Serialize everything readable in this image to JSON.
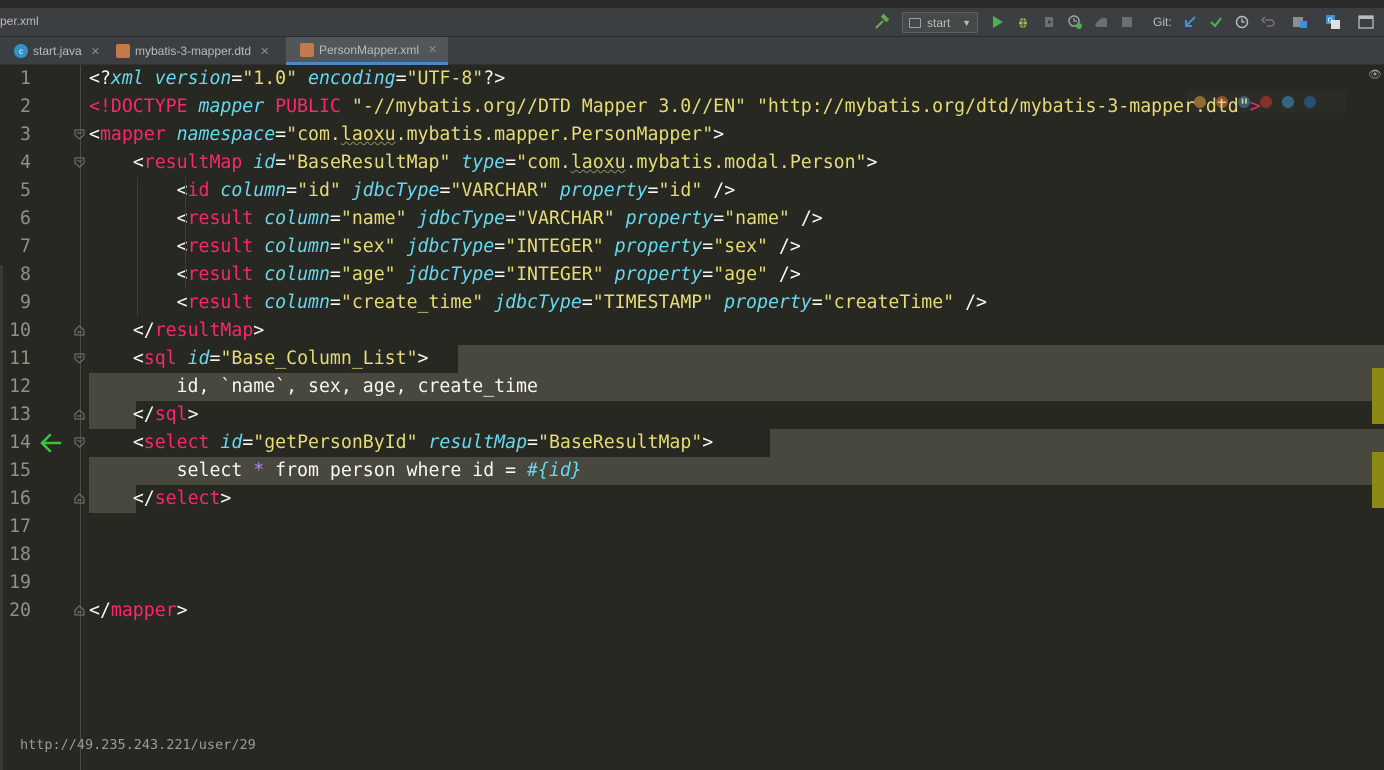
{
  "window": {
    "breadcrumb": "per.xml"
  },
  "toolbar": {
    "run_config": "start",
    "git_label": "Git:",
    "icons": [
      "hammer-icon",
      "run-icon",
      "debug-icon",
      "coverage-icon",
      "profile-icon",
      "attach-icon",
      "stop-icon",
      "git-update-icon",
      "git-commit-icon",
      "git-history-icon",
      "git-revert-icon",
      "project-structure-icon",
      "translate-icon",
      "terminal-icon"
    ],
    "colors": {
      "run": "#4caf50",
      "debug": "#9abe47",
      "update": "#3d8fd6"
    }
  },
  "tabs": [
    {
      "label": "start.java",
      "icon": "java-class-icon",
      "active": false
    },
    {
      "label": "mybatis-3-mapper.dtd",
      "icon": "dtd-file-icon",
      "active": false
    },
    {
      "label": "PersonMapper.xml",
      "icon": "xml-file-icon",
      "active": true
    }
  ],
  "editor": {
    "lines": [
      {
        "n": "1",
        "tokens": [
          [
            "pi",
            "<?"
          ],
          [
            "attr",
            "xml"
          ],
          [
            "plain",
            " "
          ],
          [
            "attr",
            "version"
          ],
          [
            "plain",
            "="
          ],
          [
            "str",
            "\"1.0\""
          ],
          [
            "plain",
            " "
          ],
          [
            "attr",
            "encoding"
          ],
          [
            "plain",
            "="
          ],
          [
            "str",
            "\"UTF-8\""
          ],
          [
            "pi",
            "?>"
          ]
        ]
      },
      {
        "n": "2",
        "tokens": [
          [
            "tag",
            "<!DOCTYPE "
          ],
          [
            "attr",
            "mapper"
          ],
          [
            "tag",
            " PUBLIC "
          ],
          [
            "str",
            "\"-//mybatis.org//DTD Mapper 3.0//EN\""
          ],
          [
            "plain",
            " "
          ],
          [
            "str",
            "\"http://mybatis.org/dtd/mybatis-3-mapper.dtd\""
          ],
          [
            "tag",
            ">"
          ]
        ]
      },
      {
        "n": "3",
        "tokens": [
          [
            "punc",
            "<"
          ],
          [
            "tag",
            "mapper"
          ],
          [
            "plain",
            " "
          ],
          [
            "attr",
            "namespace"
          ],
          [
            "plain",
            "="
          ],
          [
            "str",
            "\"com."
          ],
          [
            "strsq",
            "laoxu"
          ],
          [
            "str",
            ".mybatis.mapper.PersonMapper\""
          ],
          [
            "punc",
            ">"
          ]
        ]
      },
      {
        "n": "4",
        "tokens": [
          [
            "plain",
            "    "
          ],
          [
            "punc",
            "<"
          ],
          [
            "tag",
            "resultMap"
          ],
          [
            "plain",
            " "
          ],
          [
            "attr",
            "id"
          ],
          [
            "plain",
            "="
          ],
          [
            "str",
            "\"BaseResultMap\""
          ],
          [
            "plain",
            " "
          ],
          [
            "attr",
            "type"
          ],
          [
            "plain",
            "="
          ],
          [
            "str",
            "\"com."
          ],
          [
            "strsq",
            "laoxu"
          ],
          [
            "str",
            ".mybatis.modal.Person\""
          ],
          [
            "punc",
            ">"
          ]
        ]
      },
      {
        "n": "5",
        "tokens": [
          [
            "plain",
            "        "
          ],
          [
            "punc",
            "<"
          ],
          [
            "tag",
            "id"
          ],
          [
            "plain",
            " "
          ],
          [
            "attr",
            "column"
          ],
          [
            "plain",
            "="
          ],
          [
            "str",
            "\"id\""
          ],
          [
            "plain",
            " "
          ],
          [
            "attr",
            "jdbcType"
          ],
          [
            "plain",
            "="
          ],
          [
            "str",
            "\"VARCHAR\""
          ],
          [
            "plain",
            " "
          ],
          [
            "attr",
            "property"
          ],
          [
            "plain",
            "="
          ],
          [
            "str",
            "\"id\""
          ],
          [
            "plain",
            " />"
          ]
        ]
      },
      {
        "n": "6",
        "tokens": [
          [
            "plain",
            "        "
          ],
          [
            "punc",
            "<"
          ],
          [
            "tag",
            "result"
          ],
          [
            "plain",
            " "
          ],
          [
            "attr",
            "column"
          ],
          [
            "plain",
            "="
          ],
          [
            "str",
            "\"name\""
          ],
          [
            "plain",
            " "
          ],
          [
            "attr",
            "jdbcType"
          ],
          [
            "plain",
            "="
          ],
          [
            "str",
            "\"VARCHAR\""
          ],
          [
            "plain",
            " "
          ],
          [
            "attr",
            "property"
          ],
          [
            "plain",
            "="
          ],
          [
            "str",
            "\"name\""
          ],
          [
            "plain",
            " />"
          ]
        ]
      },
      {
        "n": "7",
        "tokens": [
          [
            "plain",
            "        "
          ],
          [
            "punc",
            "<"
          ],
          [
            "tag",
            "result"
          ],
          [
            "plain",
            " "
          ],
          [
            "attr",
            "column"
          ],
          [
            "plain",
            "="
          ],
          [
            "str",
            "\"sex\""
          ],
          [
            "plain",
            " "
          ],
          [
            "attr",
            "jdbcType"
          ],
          [
            "plain",
            "="
          ],
          [
            "str",
            "\"INTEGER\""
          ],
          [
            "plain",
            " "
          ],
          [
            "attr",
            "property"
          ],
          [
            "plain",
            "="
          ],
          [
            "str",
            "\"sex\""
          ],
          [
            "plain",
            " />"
          ]
        ]
      },
      {
        "n": "8",
        "tokens": [
          [
            "plain",
            "        "
          ],
          [
            "punc",
            "<"
          ],
          [
            "tag",
            "result"
          ],
          [
            "plain",
            " "
          ],
          [
            "attr",
            "column"
          ],
          [
            "plain",
            "="
          ],
          [
            "str",
            "\"age\""
          ],
          [
            "plain",
            " "
          ],
          [
            "attr",
            "jdbcType"
          ],
          [
            "plain",
            "="
          ],
          [
            "str",
            "\"INTEGER\""
          ],
          [
            "plain",
            " "
          ],
          [
            "attr",
            "property"
          ],
          [
            "plain",
            "="
          ],
          [
            "str",
            "\"age\""
          ],
          [
            "plain",
            " />"
          ]
        ]
      },
      {
        "n": "9",
        "tokens": [
          [
            "plain",
            "        "
          ],
          [
            "punc",
            "<"
          ],
          [
            "tag",
            "result"
          ],
          [
            "plain",
            " "
          ],
          [
            "attr",
            "column"
          ],
          [
            "plain",
            "="
          ],
          [
            "str",
            "\"create_time\""
          ],
          [
            "plain",
            " "
          ],
          [
            "attr",
            "jdbcType"
          ],
          [
            "plain",
            "="
          ],
          [
            "str",
            "\"TIMESTAMP\""
          ],
          [
            "plain",
            " "
          ],
          [
            "attr",
            "property"
          ],
          [
            "plain",
            "="
          ],
          [
            "str",
            "\"createTime\""
          ],
          [
            "plain",
            " />"
          ]
        ]
      },
      {
        "n": "10",
        "tokens": [
          [
            "plain",
            "    "
          ],
          [
            "punc",
            "</"
          ],
          [
            "tag",
            "resultMap"
          ],
          [
            "punc",
            ">"
          ]
        ]
      },
      {
        "n": "11",
        "tokens": [
          [
            "plain",
            "    "
          ],
          [
            "punc",
            "<"
          ],
          [
            "tag",
            "sql"
          ],
          [
            "plain",
            " "
          ],
          [
            "attr",
            "id"
          ],
          [
            "plain",
            "="
          ],
          [
            "str",
            "\"Base_Column_List\""
          ],
          [
            "punc",
            ">"
          ]
        ]
      },
      {
        "n": "12",
        "tokens": [
          [
            "plain",
            "        id, `name`, sex, age, create_time"
          ]
        ]
      },
      {
        "n": "13",
        "tokens": [
          [
            "plain",
            "    "
          ],
          [
            "punc",
            "</"
          ],
          [
            "tag",
            "sql"
          ],
          [
            "punc",
            ">"
          ]
        ]
      },
      {
        "n": "14",
        "tokens": [
          [
            "plain",
            "    "
          ],
          [
            "punc",
            "<"
          ],
          [
            "tag",
            "select"
          ],
          [
            "plain",
            " "
          ],
          [
            "attr",
            "id"
          ],
          [
            "plain",
            "="
          ],
          [
            "str",
            "\"getPersonById\""
          ],
          [
            "plain",
            " "
          ],
          [
            "attr",
            "resultMap"
          ],
          [
            "plain",
            "="
          ],
          [
            "str",
            "\"BaseResultMap\""
          ],
          [
            "punc",
            ">"
          ]
        ]
      },
      {
        "n": "15",
        "tokens": [
          [
            "plain",
            "        select "
          ],
          [
            "star",
            "*"
          ],
          [
            "plain",
            " from person where id = "
          ],
          [
            "param",
            "#{id}"
          ]
        ]
      },
      {
        "n": "16",
        "tokens": [
          [
            "plain",
            "    "
          ],
          [
            "punc",
            "</"
          ],
          [
            "tag",
            "select"
          ],
          [
            "punc",
            ">"
          ]
        ]
      },
      {
        "n": "17",
        "tokens": []
      },
      {
        "n": "18",
        "tokens": []
      },
      {
        "n": "19",
        "tokens": []
      },
      {
        "n": "20",
        "tokens": [
          [
            "punc",
            "</"
          ],
          [
            "tag",
            "mapper"
          ],
          [
            "punc",
            ">"
          ]
        ]
      }
    ]
  },
  "status": {
    "url": "http://49.235.243.221/user/29"
  }
}
